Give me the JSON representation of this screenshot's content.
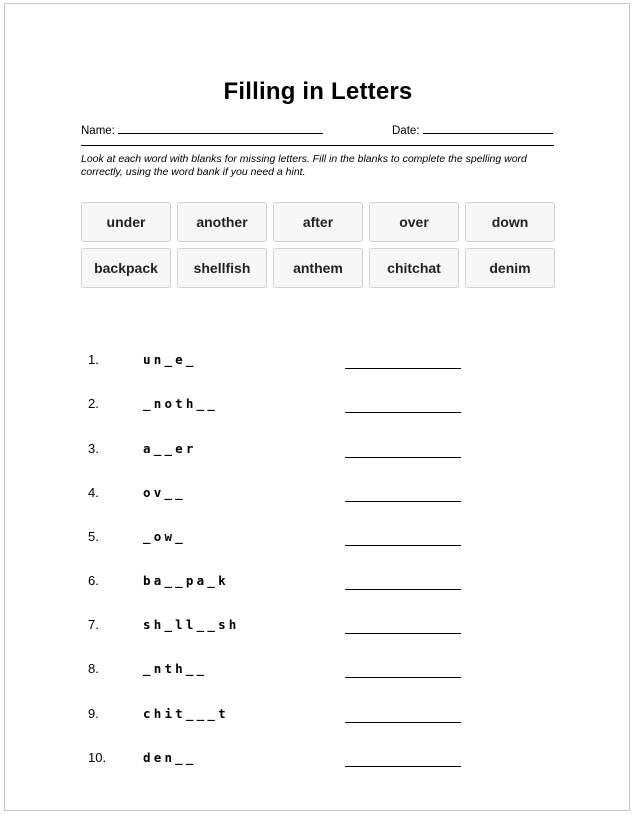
{
  "worksheet": {
    "title": "Filling in Letters",
    "name_label": "Name:",
    "date_label": "Date:",
    "instructions": "Look at each word with blanks for missing letters. Fill in the blanks to complete the spelling word correctly, using the word bank if you need a hint."
  },
  "word_bank": [
    "under",
    "another",
    "after",
    "over",
    "down",
    "backpack",
    "shellfish",
    "anthem",
    "chitchat",
    "denim"
  ],
  "problems": [
    {
      "number": "1.",
      "puzzle": "un_e_"
    },
    {
      "number": "2.",
      "puzzle": "_noth__"
    },
    {
      "number": "3.",
      "puzzle": "a__er"
    },
    {
      "number": "4.",
      "puzzle": "ov__"
    },
    {
      "number": "5.",
      "puzzle": "_ow_"
    },
    {
      "number": "6.",
      "puzzle": "ba__pa_k"
    },
    {
      "number": "7.",
      "puzzle": "sh_ll__sh"
    },
    {
      "number": "8.",
      "puzzle": "_nth__"
    },
    {
      "number": "9.",
      "puzzle": "chit___t"
    },
    {
      "number": "10.",
      "puzzle": "den__"
    }
  ]
}
